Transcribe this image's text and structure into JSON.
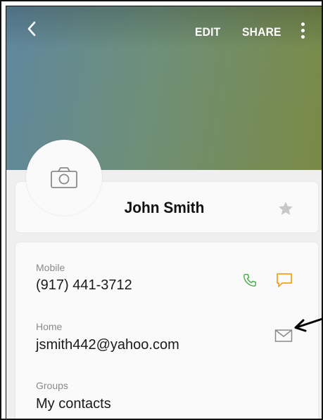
{
  "toolbar": {
    "edit_label": "EDIT",
    "share_label": "SHARE",
    "back_icon": "chevron-left-icon",
    "more_icon": "more-vert-icon"
  },
  "contact": {
    "name": "John Smith",
    "avatar_icon": "camera-icon",
    "favorite_icon": "star-icon"
  },
  "fields": {
    "mobile_label": "Mobile",
    "mobile_value": "(917) 441-3712",
    "home_label": "Home",
    "home_value": "jsmith442@yahoo.com",
    "groups_label": "Groups",
    "groups_value": "My contacts"
  },
  "colors": {
    "call_icon": "#4caf50",
    "message_icon": "#f0a020",
    "star_icon": "#c8c8c8"
  }
}
